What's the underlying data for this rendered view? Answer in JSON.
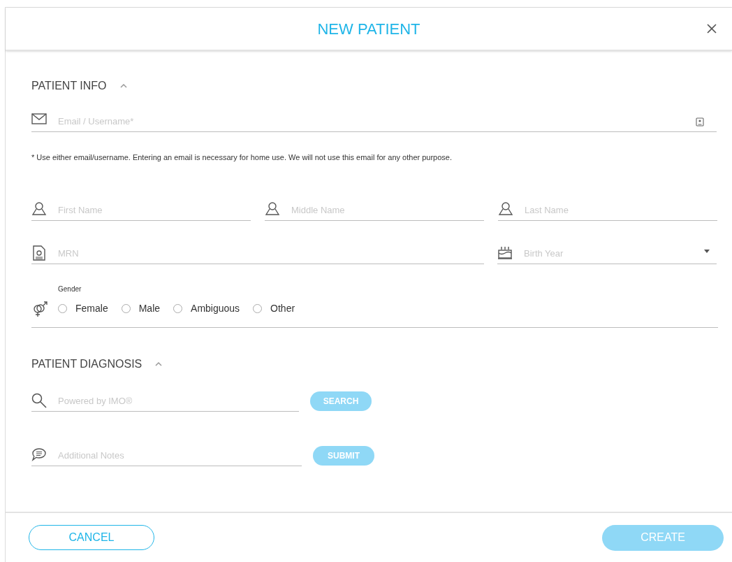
{
  "dialog": {
    "title": "NEW PATIENT"
  },
  "patient_info": {
    "heading": "PATIENT INFO",
    "expanded": true,
    "email": {
      "placeholder": "Email / Username*"
    },
    "note": "* Use either email/username. Entering an email is necessary for home use. We will not use this email for any other purpose.",
    "names": [
      {
        "placeholder": "First Name"
      },
      {
        "placeholder": "Middle Name"
      },
      {
        "placeholder": "Last Name"
      }
    ],
    "mrn": {
      "placeholder": "MRN"
    },
    "birth_year": {
      "placeholder": "Birth Year"
    },
    "gender": {
      "label": "Gender",
      "options": [
        {
          "label": "Female",
          "selected": false
        },
        {
          "label": "Male",
          "selected": false
        },
        {
          "label": "Ambiguous",
          "selected": false
        },
        {
          "label": "Other",
          "selected": false
        }
      ]
    }
  },
  "patient_diagnosis": {
    "heading": "PATIENT DIAGNOSIS",
    "expanded": true,
    "search": {
      "placeholder": "Powered by IMO®",
      "button": "SEARCH",
      "disabled": true
    },
    "notes": {
      "placeholder": "Additional Notes",
      "button": "SUBMIT",
      "disabled": true
    }
  },
  "footer": {
    "cancel": "CANCEL",
    "create": {
      "label": "CREATE",
      "disabled": true
    }
  }
}
